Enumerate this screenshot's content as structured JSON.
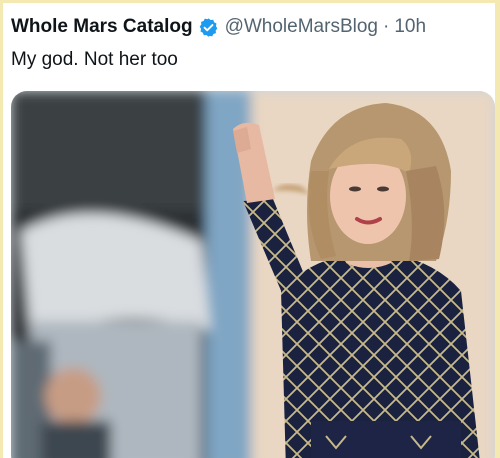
{
  "tweet": {
    "display_name": "Whole Mars Catalog",
    "handle": "@WholeMarsBlog",
    "separator": "·",
    "timestamp": "10h",
    "text": "My god. Not her too",
    "verified_icon": "verified-badge-icon"
  },
  "colors": {
    "frame": "#f4e9b0",
    "verified": "#1d9bf0",
    "name": "#0f1419",
    "secondary": "#536471"
  }
}
